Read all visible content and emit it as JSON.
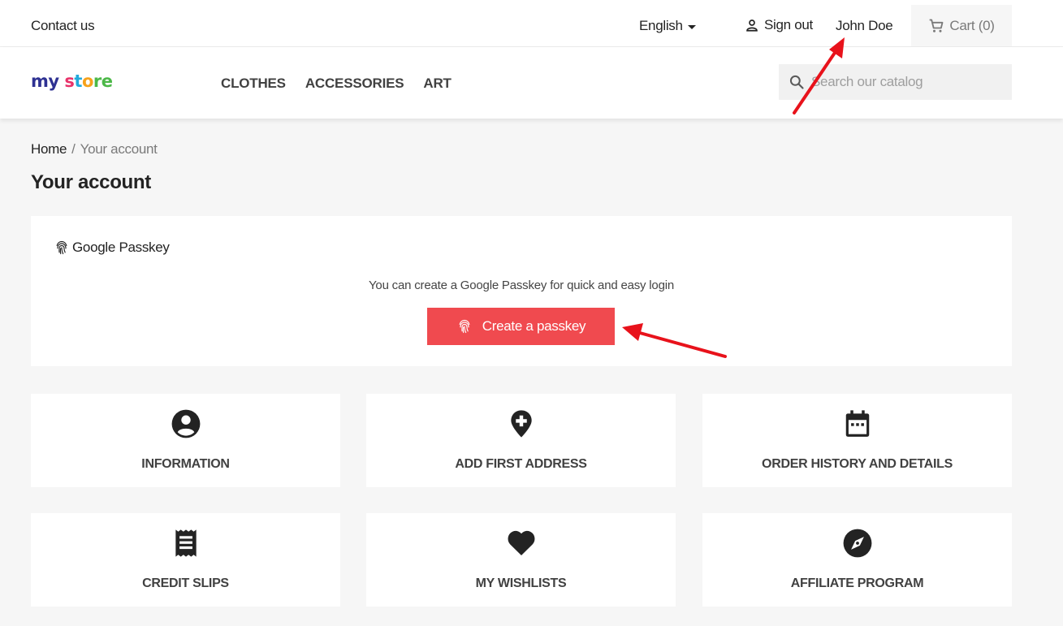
{
  "topbar": {
    "contact": "Contact us",
    "language": "English",
    "sign_out": "Sign out",
    "user_name": "John Doe",
    "cart": "Cart (0)"
  },
  "header": {
    "logo": {
      "part1": "my",
      "part2": "s",
      "part3": "t",
      "part4": "o",
      "part5": "re"
    },
    "nav": [
      "CLOTHES",
      "ACCESSORIES",
      "ART"
    ],
    "search_placeholder": "Search our catalog"
  },
  "breadcrumb": {
    "home": "Home",
    "separator": "/",
    "current": "Your account"
  },
  "page_title": "Your account",
  "passkey": {
    "heading": "Google Passkey",
    "message": "You can create a Google Passkey for quick and easy login",
    "button": "Create a passkey"
  },
  "tiles": [
    {
      "label": "INFORMATION",
      "icon": "user-circle-icon"
    },
    {
      "label": "ADD FIRST ADDRESS",
      "icon": "map-pin-plus-icon"
    },
    {
      "label": "ORDER HISTORY AND DETAILS",
      "icon": "calendar-icon"
    },
    {
      "label": "CREDIT SLIPS",
      "icon": "receipt-icon"
    },
    {
      "label": "MY WISHLISTS",
      "icon": "heart-icon"
    },
    {
      "label": "AFFILIATE PROGRAM",
      "icon": "compass-icon"
    }
  ],
  "colors": {
    "accent": "#f04a4f",
    "annotation_arrow": "#e8121b",
    "background": "#f6f6f6"
  }
}
